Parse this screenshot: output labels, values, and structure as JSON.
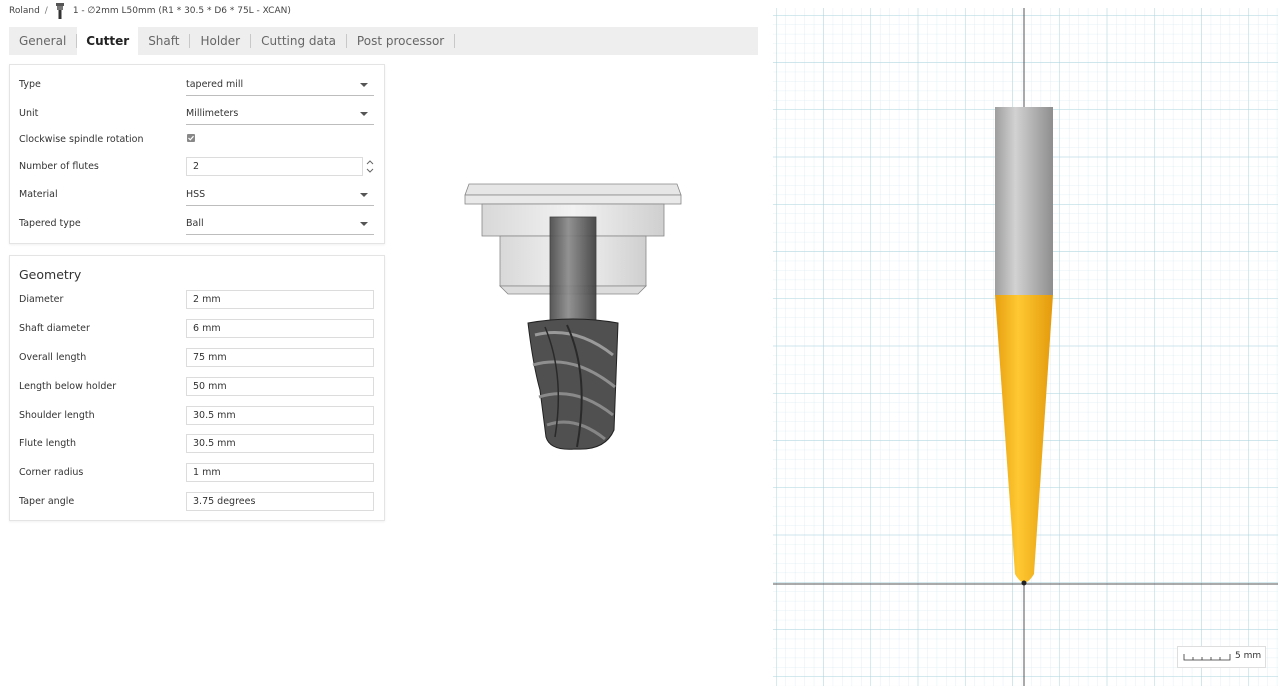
{
  "breadcrumb": {
    "root": "Roland",
    "separator": "/",
    "tool_name": "1 - ∅2mm L50mm (R1 * 30.5 * D6 * 75L - XCAN)"
  },
  "tabs": [
    {
      "label": "General",
      "active": false
    },
    {
      "label": "Cutter",
      "active": true
    },
    {
      "label": "Shaft",
      "active": false
    },
    {
      "label": "Holder",
      "active": false
    },
    {
      "label": "Cutting data",
      "active": false
    },
    {
      "label": "Post processor",
      "active": false
    }
  ],
  "cutter": {
    "type": {
      "label": "Type",
      "value": "tapered mill"
    },
    "unit": {
      "label": "Unit",
      "value": "Millimeters"
    },
    "clockwise": {
      "label": "Clockwise spindle rotation",
      "checked": true
    },
    "flutes": {
      "label": "Number of flutes",
      "value": "2"
    },
    "material": {
      "label": "Material",
      "value": "HSS"
    },
    "tapered_type": {
      "label": "Tapered type",
      "value": "Ball"
    }
  },
  "geometry": {
    "title": "Geometry",
    "fields": [
      {
        "label": "Diameter",
        "value": "2 mm"
      },
      {
        "label": "Shaft diameter",
        "value": "6 mm"
      },
      {
        "label": "Overall length",
        "value": "75 mm"
      },
      {
        "label": "Length below holder",
        "value": "50 mm"
      },
      {
        "label": "Shoulder length",
        "value": "30.5 mm"
      },
      {
        "label": "Flute length",
        "value": "30.5 mm"
      },
      {
        "label": "Corner radius",
        "value": "1 mm"
      },
      {
        "label": "Taper angle",
        "value": "3.75 degrees"
      }
    ]
  },
  "viewer": {
    "scale_label": "5 mm",
    "shaft_color": "#b8b8b8",
    "flute_color": "#f5b21e"
  },
  "icons": {
    "checkbox": "checkmark-icon",
    "dropdown": "chevron-down-icon",
    "spinner": "spinner-arrows-icon",
    "tool": "endmill-icon"
  }
}
